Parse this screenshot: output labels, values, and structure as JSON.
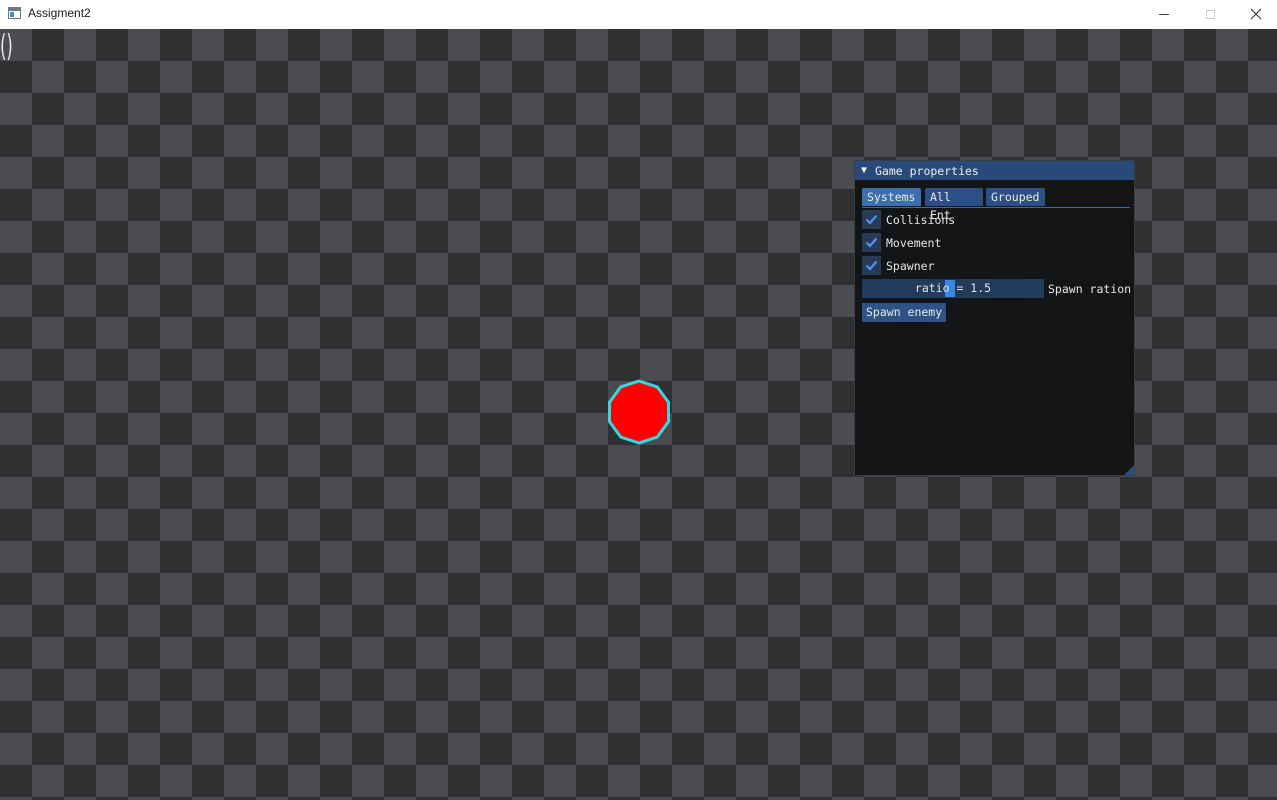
{
  "window": {
    "title": "Assigment2",
    "icon": "app-window-icon",
    "controls": [
      "minimize-icon",
      "maximize-icon",
      "close-icon"
    ]
  },
  "game": {
    "corner_text": "()",
    "entity": {
      "shape": "decagon",
      "fill_color": "#ff0000",
      "outline_color": "#34d9e0"
    },
    "colors": {
      "checker_dark": "#2f3032",
      "checker_light": "#4a4c4f"
    }
  },
  "panel": {
    "title": "Game properties",
    "collapse_icon": "triangle-down-icon",
    "tabs": [
      {
        "label": "Systems",
        "active": true
      },
      {
        "label": "All Ent",
        "active": false
      },
      {
        "label": "Grouped",
        "active": false
      }
    ],
    "checkboxes": [
      {
        "label": "Collisions",
        "checked": true
      },
      {
        "label": "Movement",
        "checked": true
      },
      {
        "label": "Spawner",
        "checked": true
      }
    ],
    "slider": {
      "value_text": "ratio = 1.5",
      "label": "Spawn ration"
    },
    "button_label": "Spawn enemy",
    "colors": {
      "header": "#29497a",
      "accent": "#3d86e0",
      "check": "#4d94ef"
    }
  }
}
